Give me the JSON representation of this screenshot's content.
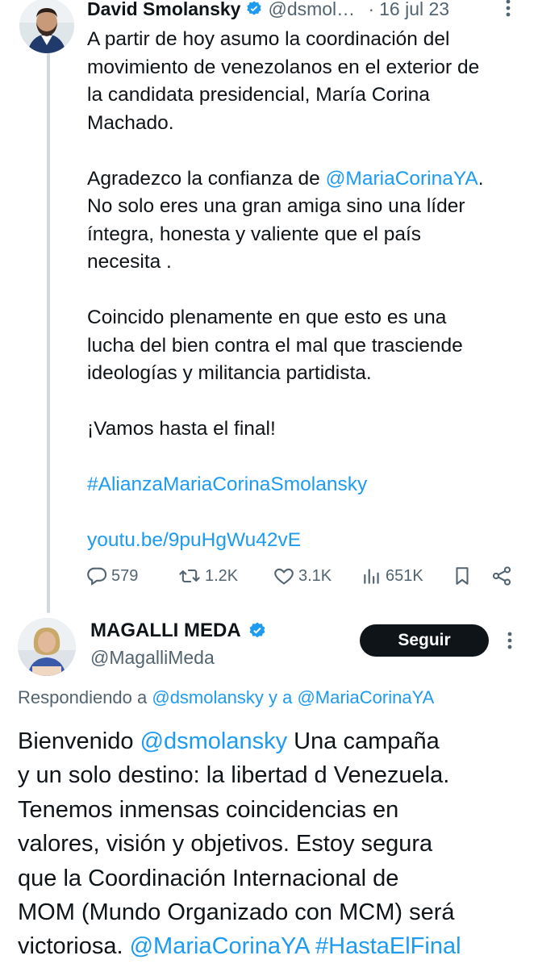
{
  "tweet1": {
    "author_name": "David Smolansky",
    "author_handle": "@dsmolansky",
    "separator": "·",
    "date": "16 jul 23",
    "body": {
      "p1": "A partir de hoy asumo la coordinación del\nmovimiento de venezolanos en el exterior de\nla candidata presidencial, María Corina\nMachado.",
      "p2_prefix": "Agradezco la confianza de ",
      "p2_mention": "@MariaCorinaYA",
      "p2_suffix": ".\nNo solo eres una gran amiga sino una líder\níntegra, honesta y valiente que el país\nnecesita .",
      "p3": "Coincido plenamente en que esto es una\nlucha del bien contra el mal que trasciende\nideologías y militancia partidista.",
      "p4": "¡Vamos hasta el final!",
      "hashtag": "#AlianzaMariaCorinaSmolansky",
      "link": "youtu.be/9puHgWu42vE"
    },
    "stats": {
      "replies": "579",
      "retweets": "1.2K",
      "likes": "3.1K",
      "views": "651K"
    }
  },
  "reply": {
    "author_name": "MAGALLI MEDA",
    "author_handle": "@MagalliMeda",
    "follow_label": "Seguir",
    "replying_prefix": "Respondiendo a ",
    "replying_to_1": "@dsmolansky",
    "replying_and": " y a ",
    "replying_to_2": "@MariaCorinaYA",
    "body": {
      "t1": "Bienvenido ",
      "mention1": "@dsmolansky",
      "t2": " Una campaña\ny un solo destino: la libertad d Venezuela.\nTenemos inmensas coincidencias en\nvalores, visión y objetivos. Estoy segura\nque la Coordinación Internacional de\nMOM (Mundo Organizado con MCM) será\nvictoriosa. ",
      "mention2": "@MariaCorinaYA",
      "space": " ",
      "hashtag": "#HastaElFinal"
    }
  },
  "colors": {
    "link": "#1d9bf0",
    "muted": "#536471",
    "text": "#0f1419",
    "verified": "#1d9bf0",
    "thread_line": "#cfd9de"
  },
  "icons": [
    "verified-badge-icon",
    "more-icon",
    "reply-icon",
    "retweet-icon",
    "like-icon",
    "views-icon",
    "bookmark-icon",
    "share-icon"
  ]
}
